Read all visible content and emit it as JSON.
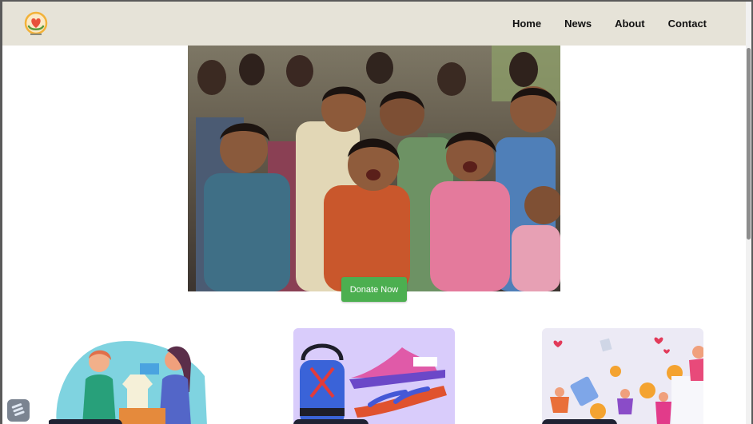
{
  "nav": {
    "logo_icon": "heart-hands-logo",
    "links": [
      "Home",
      "News",
      "About",
      "Contact"
    ]
  },
  "hero": {
    "image": "group of cheerful children",
    "cta_label": "Donate Now"
  },
  "cards": [
    {
      "illustration": "volunteers-sharing-clothes"
    },
    {
      "illustration": "shoes-and-sandals"
    },
    {
      "illustration": "people-with-coins-and-money"
    }
  ],
  "colors": {
    "navbar_bg": "#e6e3d8",
    "cta_green": "#4caf50"
  }
}
